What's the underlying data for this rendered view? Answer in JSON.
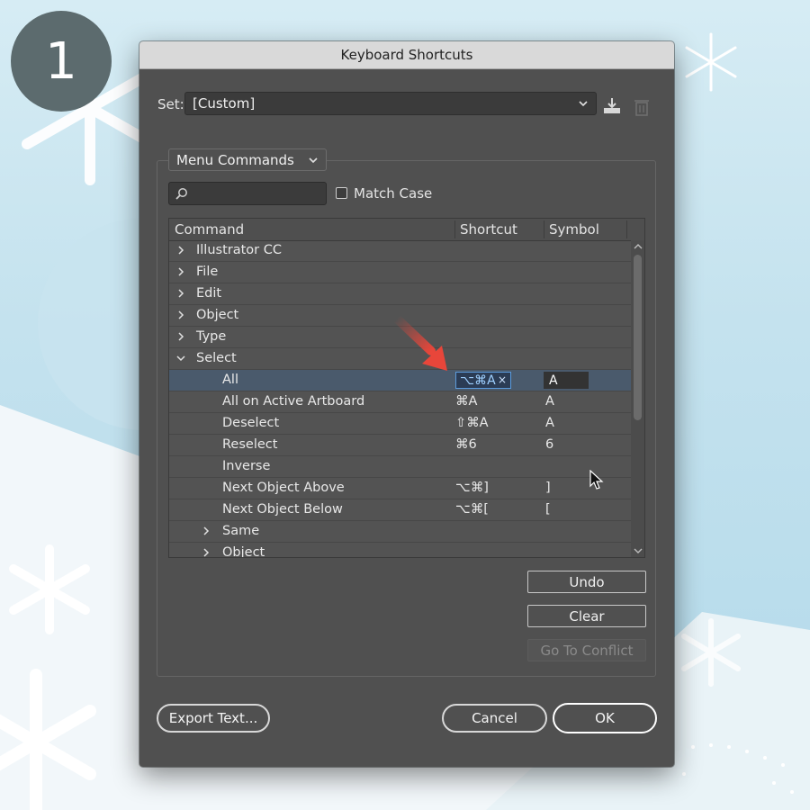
{
  "step_badge": "1",
  "dialog": {
    "title": "Keyboard Shortcuts",
    "set_label": "Set:",
    "set_value": "[Custom]",
    "category": "Menu Commands",
    "search_placeholder": "",
    "match_case_label": "Match Case",
    "columns": {
      "command": "Command",
      "shortcut": "Shortcut",
      "symbol": "Symbol"
    },
    "rows": [
      {
        "label": "Illustrator CC",
        "shortcut": "",
        "symbol": "",
        "level": 0,
        "arrow": "collapsed"
      },
      {
        "label": "File",
        "shortcut": "",
        "symbol": "",
        "level": 0,
        "arrow": "collapsed"
      },
      {
        "label": "Edit",
        "shortcut": "",
        "symbol": "",
        "level": 0,
        "arrow": "collapsed"
      },
      {
        "label": "Object",
        "shortcut": "",
        "symbol": "",
        "level": 0,
        "arrow": "collapsed"
      },
      {
        "label": "Type",
        "shortcut": "",
        "symbol": "",
        "level": 0,
        "arrow": "collapsed"
      },
      {
        "label": "Select",
        "shortcut": "",
        "symbol": "",
        "level": 0,
        "arrow": "expanded"
      },
      {
        "label": "All",
        "shortcut": "⌥⌘A",
        "symbol": "A",
        "level": 1,
        "arrow": "none",
        "selected": true
      },
      {
        "label": "All on Active Artboard",
        "shortcut": "⌘A",
        "symbol": "A",
        "level": 1,
        "arrow": "none"
      },
      {
        "label": "Deselect",
        "shortcut": "⇧⌘A",
        "symbol": "A",
        "level": 1,
        "arrow": "none"
      },
      {
        "label": "Reselect",
        "shortcut": "⌘6",
        "symbol": "6",
        "level": 1,
        "arrow": "none"
      },
      {
        "label": "Inverse",
        "shortcut": "",
        "symbol": "",
        "level": 1,
        "arrow": "none"
      },
      {
        "label": "Next Object Above",
        "shortcut": "⌥⌘]",
        "symbol": "]",
        "level": 1,
        "arrow": "none"
      },
      {
        "label": "Next Object Below",
        "shortcut": "⌥⌘[",
        "symbol": "[",
        "level": 1,
        "arrow": "none"
      },
      {
        "label": "Same",
        "shortcut": "",
        "symbol": "",
        "level": 1,
        "arrow": "collapsed"
      },
      {
        "label": "Object",
        "shortcut": "",
        "symbol": "",
        "level": 1,
        "arrow": "collapsed"
      }
    ],
    "buttons": {
      "undo": "Undo",
      "clear": "Clear",
      "go_to_conflict": "Go To Conflict",
      "export_text": "Export Text...",
      "cancel": "Cancel",
      "ok": "OK"
    }
  },
  "colors": {
    "dialog_bg": "#505050",
    "selected_row": "#4a5a6c",
    "shortcut_edit_border": "#5c9bdc",
    "annotation_arrow": "#e8463a"
  }
}
